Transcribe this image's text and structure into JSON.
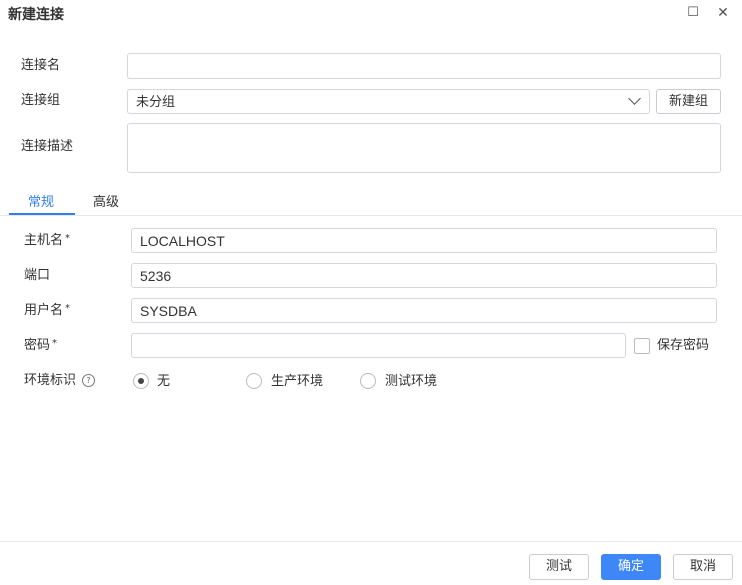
{
  "dialog": {
    "title": "新建连接",
    "maximize_glyph": "☐",
    "close_glyph": "✕"
  },
  "form": {
    "connection_name_label": "连接名",
    "connection_name_value": "",
    "connection_group_label": "连接组",
    "connection_group_value": "未分组",
    "new_group_button": "新建组",
    "description_label": "连接描述",
    "description_value": ""
  },
  "tabs": [
    {
      "label": "常规",
      "active": true
    },
    {
      "label": "高级",
      "active": false
    }
  ],
  "general": {
    "host_label": "主机名",
    "host_value": "LOCALHOST",
    "port_label": "端口",
    "port_value": "5236",
    "user_label": "用户名",
    "user_value": "SYSDBA",
    "password_label": "密码",
    "password_value": "",
    "save_password_label": "保存密码",
    "required_mark": "*",
    "env_label": "环境标识",
    "help_glyph": "?",
    "env_options": [
      {
        "label": "无",
        "selected": true
      },
      {
        "label": "生产环境",
        "selected": false
      },
      {
        "label": "测试环境",
        "selected": false
      }
    ]
  },
  "footer": {
    "test_button": "测试",
    "ok_button": "确定",
    "cancel_button": "取消"
  },
  "colors": {
    "accent": "#2d7ff0",
    "primary_button": "#3d87f7",
    "border": "#d4d7de"
  }
}
